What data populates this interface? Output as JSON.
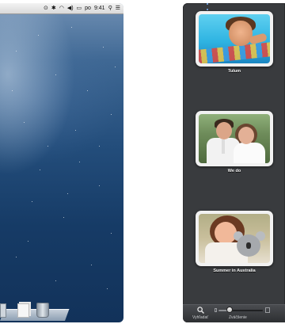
{
  "menubar": {
    "day": "po",
    "time": "9:41"
  },
  "events": [
    {
      "label": "Tulum"
    },
    {
      "label": "We do"
    },
    {
      "label": "Summer in Australia"
    }
  ],
  "toolbar": {
    "search_label": "Vyhľadať",
    "zoom_label": "Zväčšenie",
    "zoom_level": 0.25
  }
}
